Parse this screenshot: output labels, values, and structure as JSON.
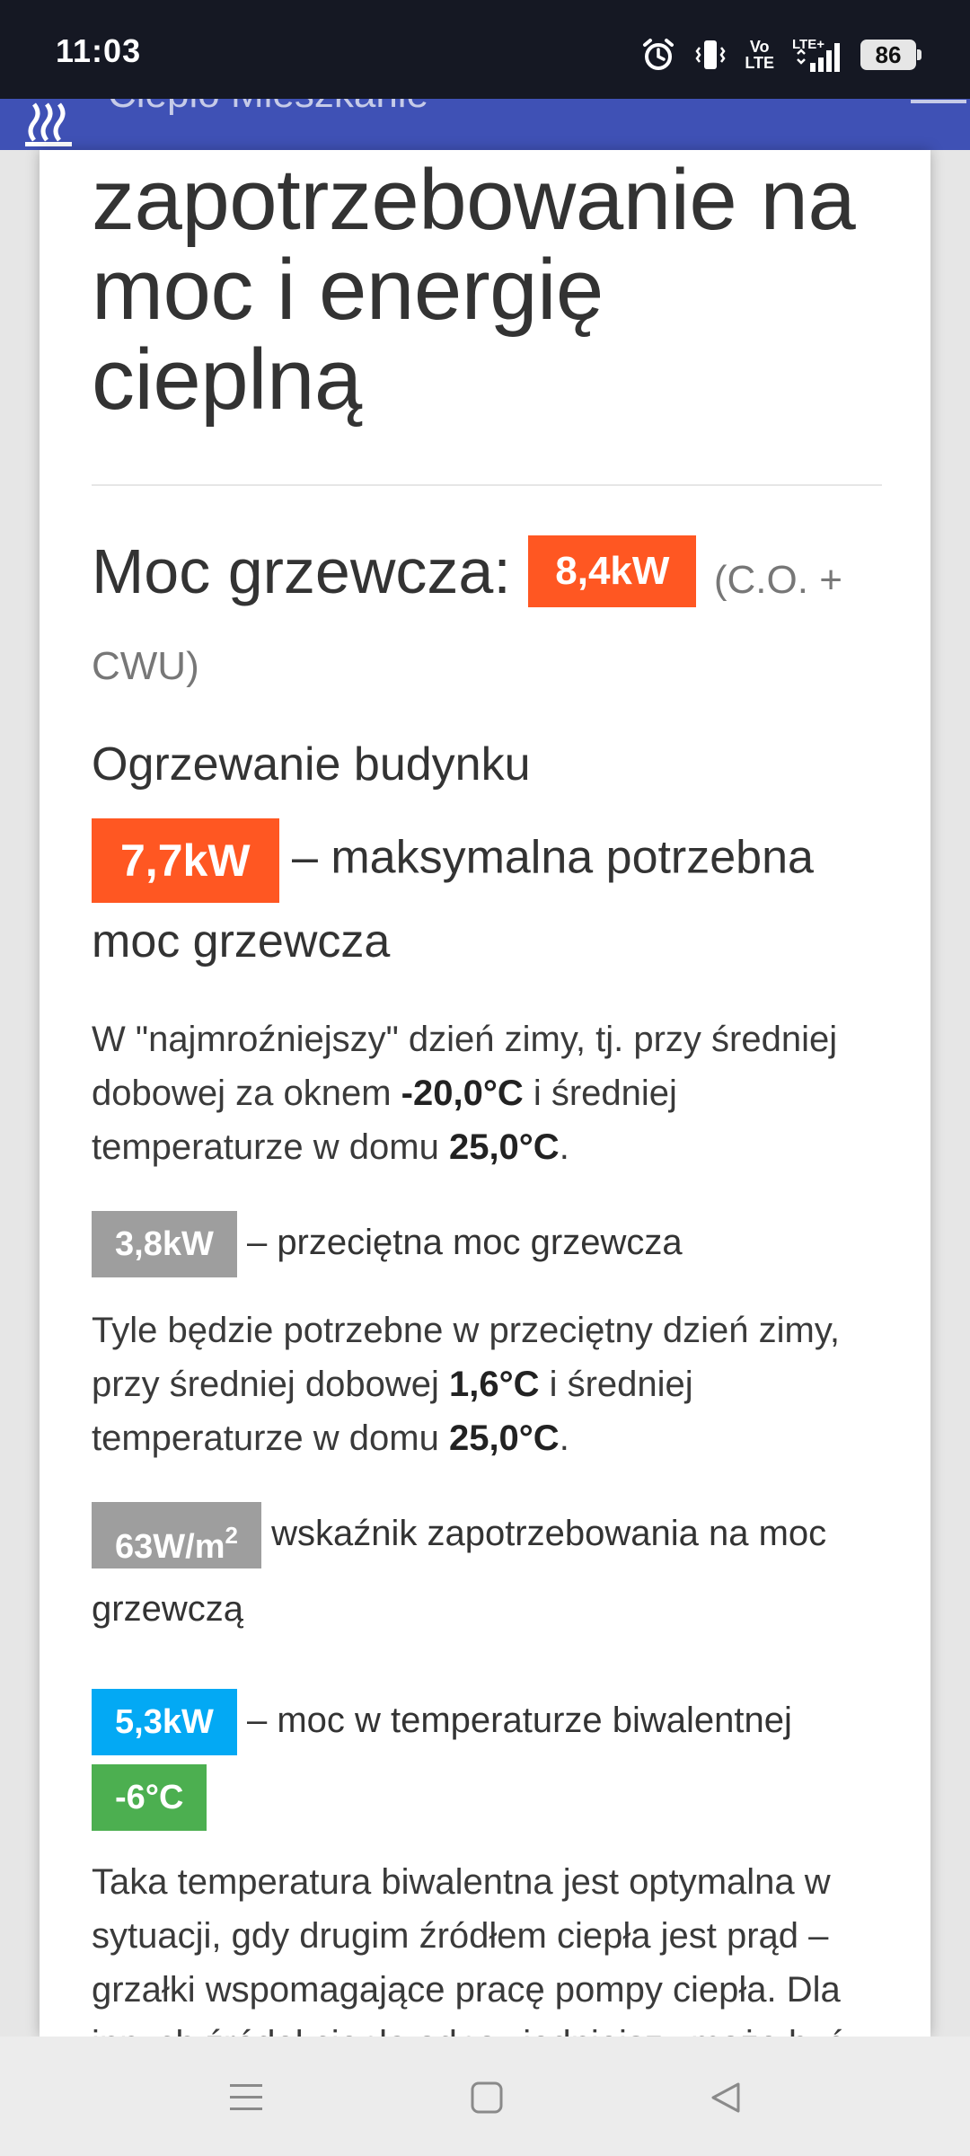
{
  "status_bar": {
    "time": "11:03",
    "icons": [
      "alarm-icon",
      "vibrate-icon",
      "volte-icon",
      "lte-signal-icon"
    ],
    "volte_label": "Vo\nLTE",
    "lte_label": "LTE+",
    "battery": "86"
  },
  "app_bar": {
    "title": "Ciepło Mieszkanie",
    "logo": "heat-waves-icon",
    "color": "#3f51b5"
  },
  "content": {
    "heading": "zapotrzebowanie na moc i energię cieplną",
    "moc_grzewcza": {
      "label": "Moc grzewcza:",
      "value": "8,4kW",
      "suffix": "(C.O. + CWU)"
    },
    "ogrzewanie": {
      "title": "Ogrzewanie budynku",
      "max": {
        "value": "7,7kW",
        "label": "– maksymalna potrzebna moc grzewcza",
        "desc_prefix": "W \"najmroźniejszy\" dzień zimy, tj. przy średniej dobowej za oknem ",
        "outside_temp": "-20,0°C",
        "desc_middle": " i średniej temperaturze w domu ",
        "inside_temp": "25,0°C",
        "desc_suffix": "."
      },
      "avg": {
        "value": "3,8kW",
        "label": "– przeciętna moc grzewcza",
        "desc_prefix": "Tyle będzie potrzebne w przeciętny dzień zimy, przy średniej dobowej ",
        "outside_temp": "1,6°C",
        "desc_middle": " i średniej temperaturze w domu ",
        "inside_temp": "25,0°C",
        "desc_suffix": "."
      },
      "wskaznik": {
        "value": "63W/m",
        "sup": "2",
        "label": "wskaźnik zapotrzebowania na moc grzewczą"
      },
      "biwalentna": {
        "value": "5,3kW",
        "label": "– moc w temperaturze biwalentnej",
        "temp": "-6°C",
        "desc": "Taka temperatura biwalentna jest optymalna w sytuacji, gdy drugim źródłem ciepła jest prąd – grzałki wspomagające pracę pompy ciepła. Dla innych źródeł ciepła odpowiedniejszy może być wybór innej temperatury biwalentnej."
      }
    },
    "colors": {
      "orange": "#ff5722",
      "gray": "#9e9e9e",
      "blue": "#03a9f4",
      "green": "#4caf50"
    }
  },
  "nav_bar": {
    "buttons": [
      "menu-icon",
      "home-icon",
      "back-icon"
    ]
  }
}
